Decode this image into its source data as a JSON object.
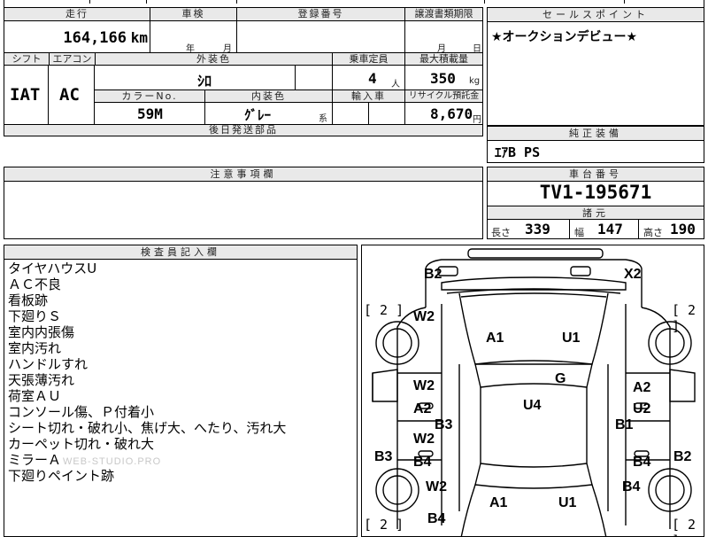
{
  "top_left": {
    "mileage_label": "走行",
    "mileage": "164,166",
    "mileage_unit": "km",
    "inspection_label": "車検",
    "inspection_year": "年",
    "inspection_month": "月",
    "registration_label": "登録番号",
    "transfer_label": "譲渡書類期限",
    "transfer_month": "月",
    "transfer_day": "日",
    "shift_label": "シフト",
    "shift": "IAT",
    "ac_label": "エアコン",
    "ac": "AC",
    "exterior_label": "外装色",
    "exterior": "ｼﾛ",
    "seats_label": "乗車定員",
    "seats": "4",
    "seats_unit": "人",
    "load_label": "最大積載量",
    "load": "350",
    "load_unit": "kg",
    "color_no_label": "カラーNo.",
    "color_no": "59M",
    "interior_label": "内装色",
    "interior": "ｸﾞﾚｰ",
    "interior_suffix": "系",
    "import_label": "輸入車",
    "recycle_label": "リサイクル預託金",
    "recycle": "8,670",
    "recycle_unit": "円",
    "parts_label": "後日発送部品"
  },
  "sales_point": {
    "label": "セールスポイント",
    "text": "★オークションデビュー★"
  },
  "genuine": {
    "label": "純正装備",
    "text": "ｴｱB PS"
  },
  "notes_box": {
    "label": "注意事項欄"
  },
  "chassis": {
    "label": "車台番号",
    "number": "TV1-195671",
    "spec_label": "諸元",
    "length_label": "長さ",
    "length": "339",
    "width_label": "幅",
    "width": "147",
    "height_label": "高さ",
    "height": "190"
  },
  "inspector": {
    "label": "検査員記入欄",
    "lines": [
      "タイヤハウスU",
      "ＡＣ不良",
      "看板跡",
      "下廻りＳ",
      "室内内張傷",
      "室内汚れ",
      "ハンドルすれ",
      "天張薄汚れ",
      "荷室ＡＵ",
      "コンソール傷、Ｐ付着小",
      "シート切れ・破れ小、焦げ大、へたり、汚れ大",
      "カーペット切れ・破れ大",
      "ミラーＡ",
      "下廻りペイント跡"
    ]
  },
  "watermark": "WEB-STUDIO.PRO",
  "diagram": {
    "bracket_top_left": "[ 2 ]",
    "bracket_top_right": "[ 2 ]",
    "bracket_bottom_left": "[ 2 ]",
    "bracket_bottom_right": "[ 2 ]",
    "marks": {
      "b2_top": "B2",
      "x2_top": "X2",
      "w2_front_left": "W2",
      "a1_bonnet": "A1",
      "u1_bonnet": "U1",
      "g_glass": "G",
      "w2_door1": "W2",
      "a2_door1": "A2",
      "w2_door2": "W2",
      "b4_door2": "B4",
      "b3_left": "B3",
      "b3_rocker": "B3",
      "u4_roof": "U4",
      "a2_right_door": "A2",
      "u2_right_door": "U2",
      "b1_right": "B1",
      "b4_right_door": "B4",
      "b2_right": "B2",
      "w2_rear_left": "W2",
      "b4_rear_right": "B4",
      "a1_rear": "A1",
      "u1_rear": "U1",
      "b4_bottom_left": "B4"
    }
  }
}
